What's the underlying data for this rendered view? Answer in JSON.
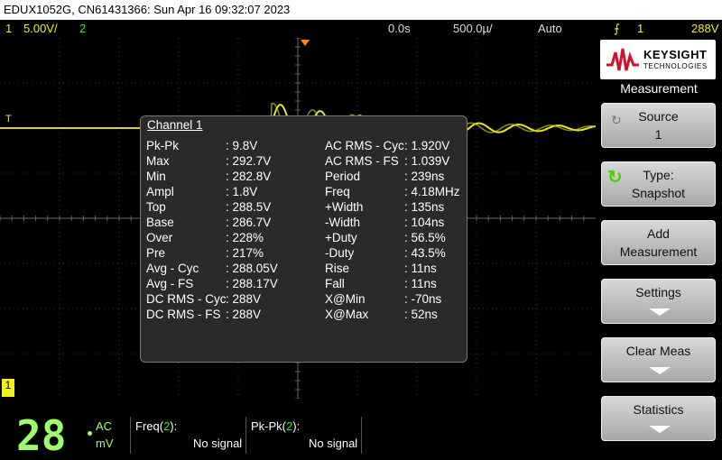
{
  "titlebar": "EDUX1052G, CN61431366: Sun Apr 16 09:32:07 2023",
  "status": {
    "ch1_num": "1",
    "ch1_scale": "5.00V/",
    "ch2_num": "2",
    "time_offset": "0.0s",
    "timebase": "500.0µ/",
    "trigger_mode": "Auto",
    "trigger_ch": "1",
    "trigger_level": "288V"
  },
  "measurement_box": {
    "header": "Channel 1",
    "left": [
      {
        "label": "Pk-Pk",
        "value": ": 9.8V"
      },
      {
        "label": "Max",
        "value": ": 292.7V"
      },
      {
        "label": "Min",
        "value": ": 282.8V"
      },
      {
        "label": "Ampl",
        "value": ": 1.8V"
      },
      {
        "label": "Top",
        "value": ": 288.5V"
      },
      {
        "label": "Base",
        "value": ": 286.7V"
      },
      {
        "label": "Over",
        "value": ": 228%"
      },
      {
        "label": "Pre",
        "value": ": 217%"
      },
      {
        "label": "Avg - Cyc",
        "value": ": 288.05V"
      },
      {
        "label": "Avg - FS",
        "value": ": 288.17V"
      },
      {
        "label": "DC RMS - Cyc",
        "value": ": 288V"
      },
      {
        "label": "DC RMS - FS",
        "value": ": 288V"
      }
    ],
    "right": [
      {
        "label": "AC RMS - Cyc",
        "value": ": 1.920V"
      },
      {
        "label": "AC RMS - FS",
        "value": ": 1.039V"
      },
      {
        "label": "Period",
        "value": ": 239ns"
      },
      {
        "label": "Freq",
        "value": ": 4.18MHz"
      },
      {
        "label": "+Width",
        "value": ": 135ns"
      },
      {
        "label": "-Width",
        "value": ": 104ns"
      },
      {
        "label": "+Duty",
        "value": ": 56.5%"
      },
      {
        "label": "-Duty",
        "value": ": 43.5%"
      },
      {
        "label": "Rise",
        "value": ": 11ns"
      },
      {
        "label": "Fall",
        "value": ": 11ns"
      },
      {
        "label": "X@Min",
        "value": ": -70ns"
      },
      {
        "label": "X@Max",
        "value": ": 52ns"
      }
    ]
  },
  "markers": {
    "trigger_t": "T",
    "ch1_ground": "1"
  },
  "right_panel": {
    "logo_line1": "KEYSIGHT",
    "logo_line2": "TECHNOLOGIES",
    "menu_title": "Measurement",
    "softkeys": [
      {
        "line1": "Source",
        "line2": "1"
      },
      {
        "line1": "Type:",
        "line2": "Snapshot"
      },
      {
        "line1": "Add",
        "line2": "Measurement"
      },
      {
        "line1": "Settings",
        "line2": ""
      },
      {
        "line1": "Clear Meas",
        "line2": ""
      },
      {
        "line1": "Statistics",
        "line2": ""
      }
    ]
  },
  "bottom": {
    "digits": "28",
    "coupling": "AC",
    "units": "mV",
    "freq_label": "Freq(",
    "freq_ch": "2",
    "freq_close": "):",
    "freq_value": "No signal",
    "pkpk_label": "Pk-Pk(",
    "pkpk_ch": "2",
    "pkpk_close": "):",
    "pkpk_value": "No signal"
  },
  "colors": {
    "ch1": "#f0f020",
    "ch2": "#40e040",
    "accent": "#ff8c00",
    "panel": "#2a2a2a"
  }
}
